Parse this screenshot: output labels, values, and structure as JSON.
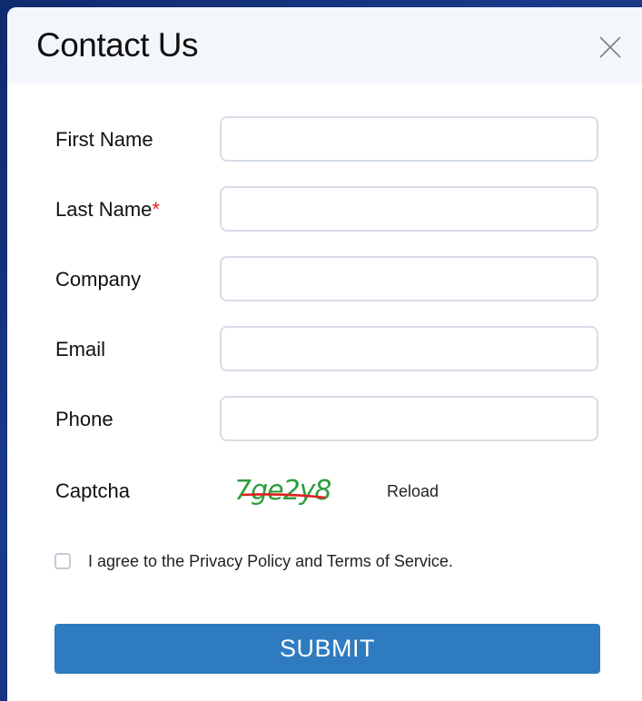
{
  "modal": {
    "title": "Contact Us",
    "close_icon": "close-icon"
  },
  "form": {
    "fields": [
      {
        "label": "First Name",
        "required": false,
        "value": "",
        "placeholder": ""
      },
      {
        "label": "Last Name",
        "required": true,
        "value": "",
        "placeholder": ""
      },
      {
        "label": "Company",
        "required": false,
        "value": "",
        "placeholder": ""
      },
      {
        "label": "Email",
        "required": false,
        "value": "",
        "placeholder": ""
      },
      {
        "label": "Phone",
        "required": false,
        "value": "",
        "placeholder": ""
      }
    ],
    "required_marker": "*",
    "captcha": {
      "label": "Captcha",
      "code": "7ge2y8",
      "reload_label": "Reload"
    },
    "agree": {
      "checked": false,
      "text": "I agree to the Privacy Policy and Terms of Service."
    },
    "submit_label": "SUBMIT"
  },
  "colors": {
    "submit_bg": "#2e7bbf",
    "required": "#e02020",
    "captcha_text": "#2e9e3e",
    "captcha_strike": "#e02020",
    "header_bg": "#f3f7fb"
  }
}
